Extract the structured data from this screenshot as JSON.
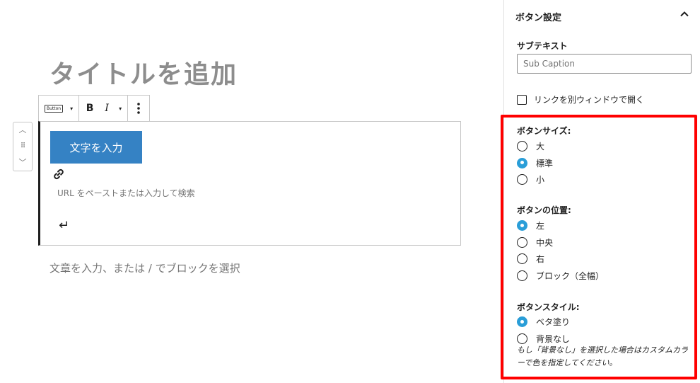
{
  "editor": {
    "title_placeholder": "タイトルを追加",
    "toolbar": {
      "block_type_label": "Button",
      "bold_label": "B",
      "italic_label": "I",
      "more_caret": "▾",
      "type_caret": "▾"
    },
    "button_block": {
      "button_text": "文字を入力",
      "url_placeholder": "URL をペーストまたは入力して検索"
    },
    "paragraph_placeholder": "文章を入力、または / でブロックを選択"
  },
  "sidebar": {
    "panel_title": "ボタン設定",
    "subtext_label": "サブテキスト",
    "subtext_placeholder": "Sub Caption",
    "new_window_label": "リンクを別ウィンドウで開く",
    "size": {
      "label": "ボタンサイズ:",
      "options": [
        {
          "label": "大",
          "checked": false
        },
        {
          "label": "標準",
          "checked": true
        },
        {
          "label": "小",
          "checked": false
        }
      ]
    },
    "position": {
      "label": "ボタンの位置:",
      "options": [
        {
          "label": "左",
          "checked": true
        },
        {
          "label": "中央",
          "checked": false
        },
        {
          "label": "右",
          "checked": false
        },
        {
          "label": "ブロック（全幅）",
          "checked": false
        }
      ]
    },
    "style": {
      "label": "ボタンスタイル:",
      "options": [
        {
          "label": "ベタ塗り",
          "checked": true
        },
        {
          "label": "背景なし",
          "checked": false
        }
      ]
    },
    "help_text": "もし「背景なし」を選択した場合はカスタムカラーで色を指定してください。"
  },
  "colors": {
    "accent": "#2a9ed8",
    "button_bg": "#3582c4",
    "highlight": "#ff0000"
  }
}
